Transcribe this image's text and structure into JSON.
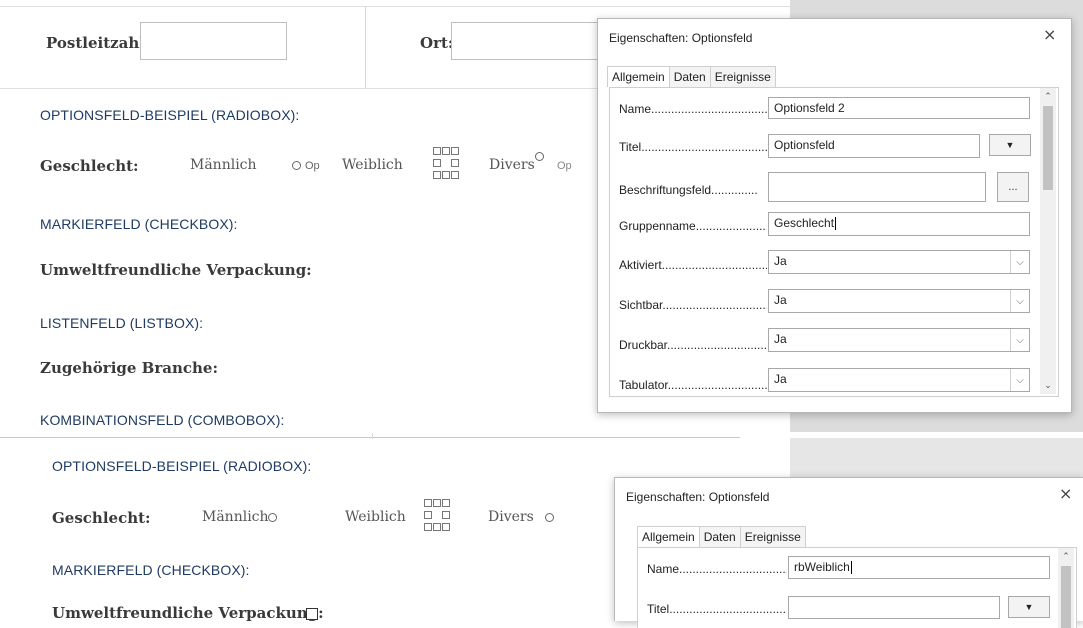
{
  "document": {
    "top": {
      "postleitzahl_label": "Postleitzahl:",
      "ort_label": "Ort:",
      "heading_radio": "OPTIONSFELD-BEISPIEL (RADIOBOX):",
      "geschlecht_label": "Geschlecht:",
      "option_maennlich": "Männlich",
      "option_maennlich_suffix": "Op",
      "option_weiblich": "Weiblich",
      "option_divers": "Divers",
      "option_divers_suffix": "Op",
      "heading_checkbox": "MARKIERFELD (CHECKBOX):",
      "umwelt_label": "Umweltfreundliche Verpackung:",
      "heading_listbox": "LISTENFELD (LISTBOX):",
      "branche_label": "Zugehörige Branche:",
      "heading_combobox": "KOMBINATIONSFELD (COMBOBOX):"
    },
    "bottom": {
      "heading_radio": "OPTIONSFELD-BEISPIEL (RADIOBOX):",
      "geschlecht_label": "Geschlecht:",
      "option_maennlich": "Männlich",
      "option_weiblich": "Weiblich",
      "option_divers": "Divers",
      "heading_checkbox": "MARKIERFELD (CHECKBOX):",
      "umwelt_label": "Umweltfreundliche Verpackung:"
    }
  },
  "dialog_top": {
    "title": "Eigenschaften: Optionsfeld",
    "close": "×",
    "tabs": [
      "Allgemein",
      "Daten",
      "Ereignisse"
    ],
    "rows": {
      "name_label": "Name.......................................",
      "name_value": "Optionsfeld 2",
      "titel_label": "Titel............................................",
      "titel_value": "Optionsfeld",
      "beschriftung_label": "Beschriftungsfeld..............",
      "beschriftung_value": "",
      "beschriftung_button": "...",
      "gruppenname_label": "Gruppenname......................",
      "gruppenname_value": "Geschlecht",
      "aktiviert_label": "Aktiviert.................................",
      "aktiviert_value": "Ja",
      "sichtbar_label": "Sichtbar..................................",
      "sichtbar_value": "Ja",
      "druckbar_label": "Druckbar.................................",
      "druckbar_value": "Ja",
      "tabulator_label": "Tabulator................................",
      "tabulator_value": "Ja"
    }
  },
  "dialog_bottom": {
    "title": "Eigenschaften: Optionsfeld",
    "close": "×",
    "tabs": [
      "Allgemein",
      "Daten",
      "Ereignisse"
    ],
    "rows": {
      "name_label": "Name.......................................",
      "name_value": "rbWeiblich",
      "titel_label": "Titel............................................",
      "titel_value": ""
    }
  }
}
